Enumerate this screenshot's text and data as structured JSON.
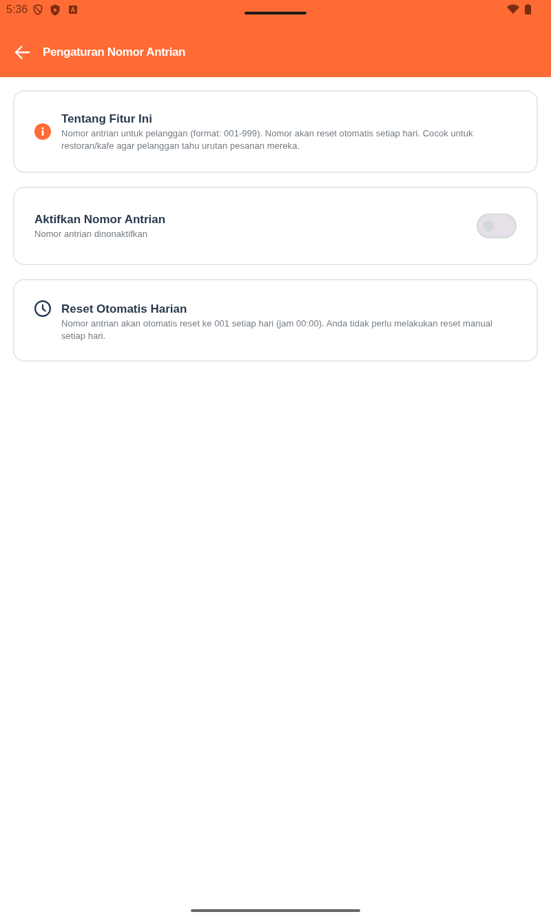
{
  "status_bar": {
    "time": "5:36"
  },
  "app_bar": {
    "title": "Pengaturan Nomor Antrian"
  },
  "cards": [
    {
      "kind": "info",
      "title": "Tentang Fitur Ini",
      "description": "Nomor antrian untuk pelanggan (format: 001-999). Nomor akan reset otomatis setiap hari. Cocok untuk restoran/kafe agar pelanggan tahu urutan pesanan mereka."
    },
    {
      "kind": "toggle",
      "title": "Aktifkan Nomor Antrian",
      "description": "Nomor antrian dinonaktifkan",
      "on": false
    },
    {
      "kind": "schedule",
      "title": "Reset Otomatis Harian",
      "description": "Nomor antrian akan otomatis reset ke 001 setiap hari (jam 00:00). Anda tidak perlu melakukan reset manual setiap hari."
    }
  ]
}
